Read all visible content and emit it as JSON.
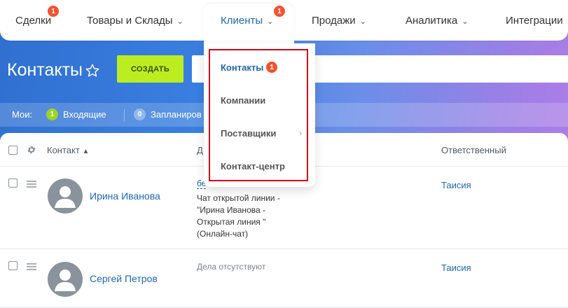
{
  "nav": {
    "items": [
      {
        "label": "Сделки",
        "badge": "1"
      },
      {
        "label": "Товары и Склады"
      },
      {
        "label": "Клиенты",
        "badge": "1"
      },
      {
        "label": "Продажи"
      },
      {
        "label": "Аналитика"
      },
      {
        "label": "Интеграции"
      }
    ],
    "chevron": "⌄"
  },
  "page": {
    "title": "Контакты",
    "create_label": "СОЗДАТЬ"
  },
  "counters": {
    "label": "Мои:",
    "incoming": {
      "count": "1",
      "label": "Входящие",
      "color": "#9dd225"
    },
    "planned": {
      "count": "0",
      "label": "Запланиров"
    }
  },
  "grid": {
    "headers": {
      "contact": "Контакт",
      "deals": "Д",
      "responsible": "Ответственный"
    },
    "rows": [
      {
        "name": "Ирина Иванова",
        "deal_link": "бе",
        "deal_text": [
          "Чат открытой линии -",
          "\"Ирина Иванова -",
          "Открытая линия \"",
          "(Онлайн-чат)"
        ],
        "responsible": "Таисия"
      },
      {
        "name": "Сергей Петров",
        "deal_empty": "Дела отсутствуют",
        "responsible": "Таисия"
      }
    ]
  },
  "menu": {
    "items": [
      {
        "label": "Контакты",
        "badge": "1"
      },
      {
        "label": "Компании"
      },
      {
        "label": "Поставщики"
      },
      {
        "label": "Контакт-центр"
      }
    ],
    "highlight_color": "#d0021b"
  },
  "colors": {
    "accent": "#2067b0",
    "create_button": "#bbed21",
    "badge": "#f2532f"
  }
}
